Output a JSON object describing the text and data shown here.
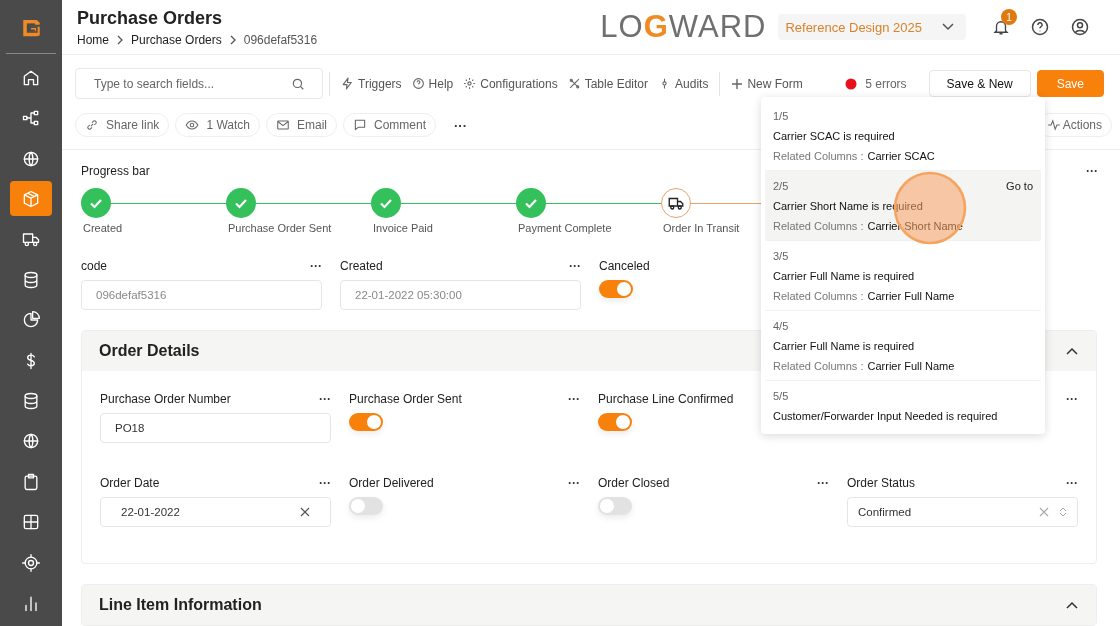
{
  "sidebar": {
    "items": [
      {
        "selected": false
      },
      {
        "selected": false
      },
      {
        "selected": false
      },
      {
        "selected": true
      },
      {
        "selected": false
      },
      {
        "selected": false
      },
      {
        "selected": false
      },
      {
        "selected": false
      },
      {
        "selected": false
      },
      {
        "selected": false
      },
      {
        "selected": false
      },
      {
        "selected": false
      },
      {
        "selected": false
      },
      {
        "selected": false
      }
    ]
  },
  "header": {
    "title": "Purchase Orders",
    "breadcrumb": [
      "Home",
      "Purchase Orders",
      "096defaf5316"
    ],
    "logo": {
      "before": "LO",
      "mark": "G",
      "after": "WARD"
    },
    "project": "Reference Design 2025",
    "notification_count": "1"
  },
  "toolbar": {
    "search_placeholder": "Type to search fields...",
    "links": [
      "Triggers",
      "Help",
      "Configurations",
      "Table Editor",
      "Audits"
    ],
    "new_form": "New Form",
    "errors": "5 errors",
    "save_new": "Save & New",
    "save": "Save"
  },
  "actions": {
    "chips": [
      "Share link",
      "1 Watch",
      "Email",
      "Comment"
    ],
    "more": "···",
    "actions": "Actions"
  },
  "progress": {
    "title": "Progress bar",
    "steps": [
      {
        "label": "Created",
        "completed": true
      },
      {
        "label": "Purchase Order Sent",
        "completed": true
      },
      {
        "label": "Invoice Paid",
        "completed": true
      },
      {
        "label": "Payment Complete",
        "completed": true
      },
      {
        "label": "Order In Transit",
        "completed": false
      }
    ]
  },
  "top_fields": [
    {
      "kind": "text",
      "label": "code",
      "value": "096defaf5316",
      "disabled": true
    },
    {
      "kind": "text",
      "label": "Created",
      "value": "22-01-2022 05:30:00",
      "disabled": true
    },
    {
      "kind": "toggle",
      "label": "Canceled",
      "on": true
    }
  ],
  "sections": [
    {
      "title": "Order Details",
      "expanded": true,
      "fields": [
        {
          "kind": "text",
          "label": "Purchase Order Number",
          "value": "PO18",
          "disabled": false
        },
        {
          "kind": "toggle",
          "label": "Purchase Order Sent",
          "on": true
        },
        {
          "kind": "toggle",
          "label": "Purchase Line Confirmed",
          "on": true
        },
        {
          "kind": "hidden"
        },
        {
          "kind": "date",
          "label": "Order Date",
          "value": "22-01-2022"
        },
        {
          "kind": "toggle",
          "label": "Order Delivered",
          "on": false
        },
        {
          "kind": "toggle",
          "label": "Order Closed",
          "on": false
        },
        {
          "kind": "select",
          "label": "Order Status",
          "value": "Confirmed"
        }
      ]
    },
    {
      "title": "Line Item Information",
      "expanded": true
    }
  ],
  "errors_popup": {
    "items": [
      {
        "index": "1/5",
        "message": "Carrier SCAC is required",
        "related_label": "Related Columns :",
        "column": "Carrier SCAC",
        "selected": false
      },
      {
        "index": "2/5",
        "message": "Carrier Short Name is required",
        "related_label": "Related Columns :",
        "column": "Carrier Short Name",
        "selected": true,
        "action": "Go to"
      },
      {
        "index": "3/5",
        "message": "Carrier Full Name is required",
        "related_label": "Related Columns :",
        "column": "Carrier Full Name",
        "selected": false
      },
      {
        "index": "4/5",
        "message": "Carrier Full Name is required",
        "related_label": "Related Columns :",
        "column": "Carrier Full Name",
        "selected": false
      },
      {
        "index": "5/5",
        "message": "Customer/Forwarder Input Needed is required",
        "selected": false
      }
    ]
  }
}
